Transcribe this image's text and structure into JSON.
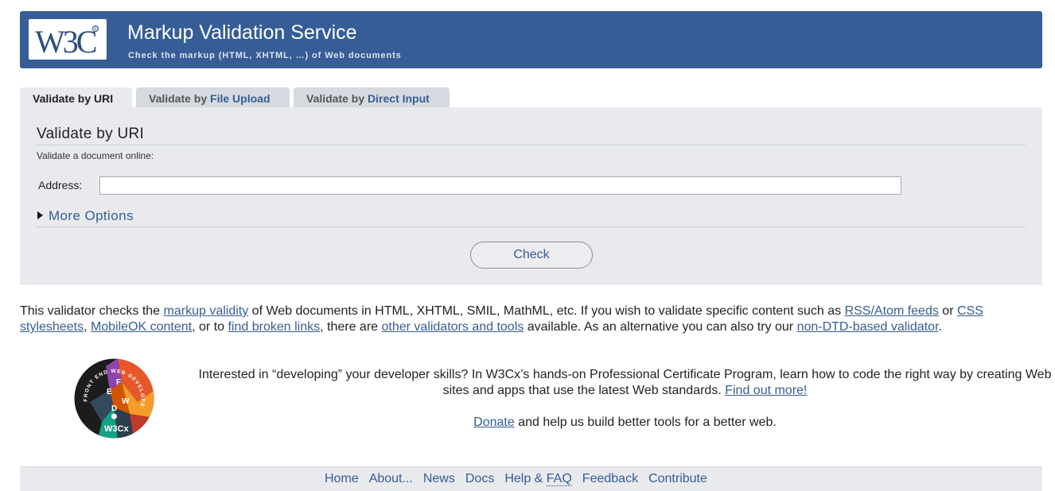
{
  "header": {
    "logo_text": "W3C",
    "title": "Markup Validation Service",
    "subtitle": "Check the markup (HTML, XHTML, …) of Web documents"
  },
  "tabs": [
    {
      "prefix": "Validate by ",
      "highlight": "URI",
      "active": true
    },
    {
      "prefix": "Validate by ",
      "highlight": "File Upload",
      "active": false
    },
    {
      "prefix": "Validate by ",
      "highlight": "Direct Input",
      "active": false
    }
  ],
  "form": {
    "title": "Validate by URI",
    "intro": "Validate a document online:",
    "address_label": "Address:",
    "address_value": "",
    "more_options": "More Options",
    "check_label": "Check"
  },
  "intro": {
    "t1": "This validator checks the ",
    "l1": "markup validity",
    "t2": " of Web documents in HTML, XHTML, SMIL, MathML, etc. If you wish to validate specific content such as ",
    "l2": "RSS/Atom feeds",
    "t3": " or ",
    "l3": "CSS stylesheets",
    "t4": ", ",
    "l4": "MobileOK content",
    "t5": ", or to ",
    "l5": "find broken links",
    "t6": ", there are ",
    "l6": "other validators and tools",
    "t7": " available. As an alternative you can also try our ",
    "l7": "non-DTD-based validator",
    "t8": "."
  },
  "promo": {
    "badge_text": "W3Cx",
    "badge_ring": "FRONT END WEB DEVELOPER",
    "badge_letters": [
      "F",
      "E",
      "W",
      "D"
    ],
    "text": "Interested in “developing” your developer skills? In W3Cx’s hands-on Professional Certificate Program, learn how to code the right way by creating Web sites and apps that use the latest Web standards. ",
    "link": "Find out more!",
    "donate_link": "Donate",
    "donate_text": " and help us build better tools for a better web."
  },
  "footer": {
    "links": {
      "home": "Home",
      "about": "About...",
      "news": "News",
      "docs": "Docs",
      "help": "Help & ",
      "faq": "FAQ",
      "feedback": "Feedback",
      "contribute": "Contribute"
    }
  },
  "colors": {
    "brand": "#365d95",
    "panel": "#e8eaee",
    "tab_inactive": "#d6dae0"
  }
}
